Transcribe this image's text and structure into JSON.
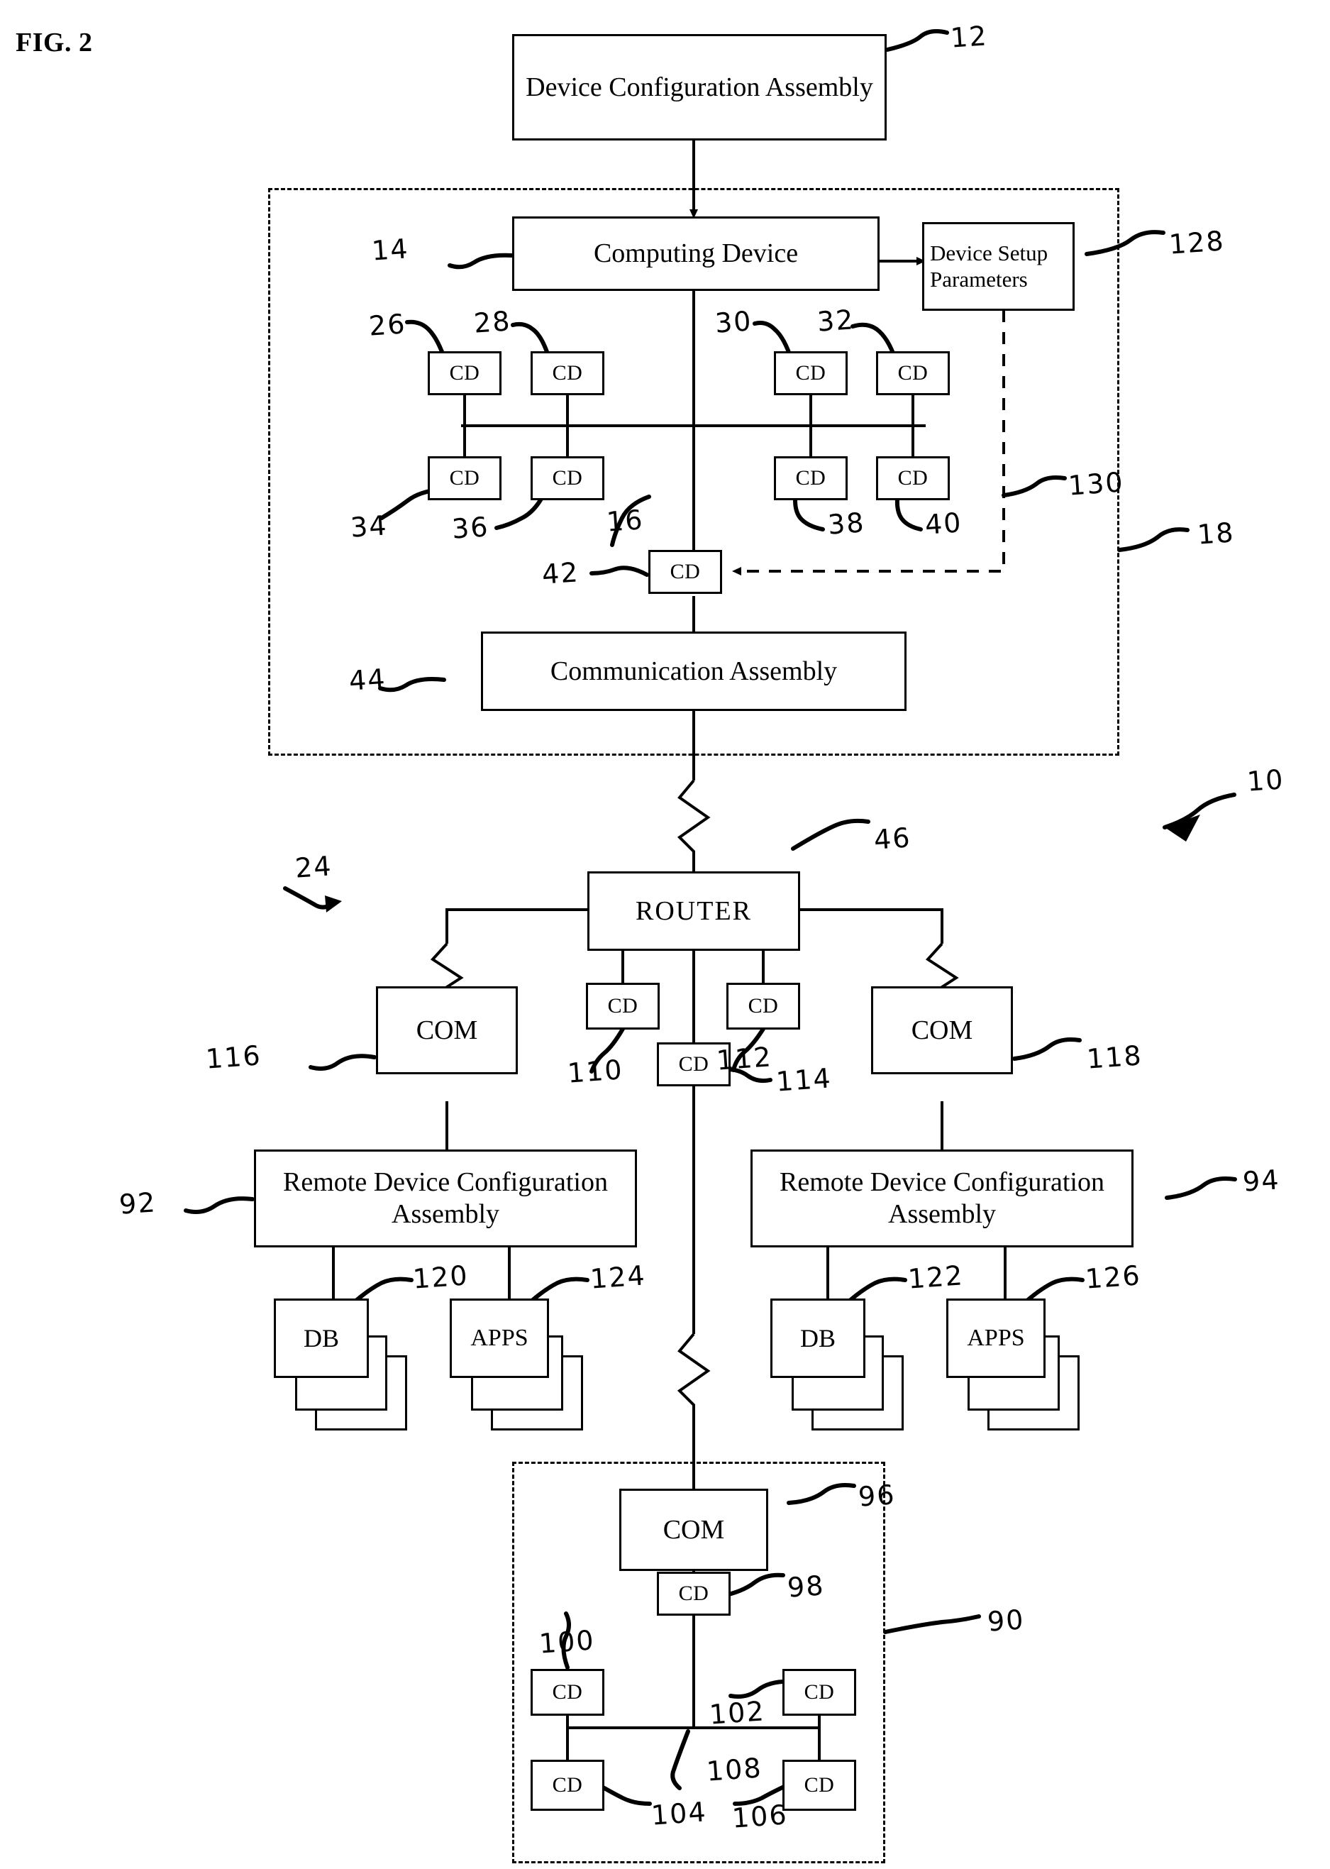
{
  "figure": {
    "label": "FIG. 2",
    "system_numeral": "10"
  },
  "boxes": {
    "device_configuration_assembly": "Device Configuration Assembly",
    "computing_device": "Computing Device",
    "device_setup_parameters": "Device Setup Parameters",
    "communication_assembly": "Communication Assembly",
    "router": "ROUTER",
    "remote_device_configuration_assembly_left": "Remote Device Configuration Assembly",
    "remote_device_configuration_assembly_right": "Remote Device Configuration Assembly",
    "com": "COM",
    "cd": "CD",
    "db": "DB",
    "apps": "APPS"
  },
  "numerals": {
    "n10": "10",
    "n12": "12",
    "n14": "14",
    "n16": "16",
    "n18": "18",
    "n24": "24",
    "n26": "26",
    "n28": "28",
    "n30": "30",
    "n32": "32",
    "n34": "34",
    "n36": "36",
    "n38": "38",
    "n40": "40",
    "n42": "42",
    "n44": "44",
    "n46": "46",
    "n90": "90",
    "n92": "92",
    "n94": "94",
    "n96": "96",
    "n98": "98",
    "n100": "100",
    "n102": "102",
    "n104": "104",
    "n106": "106",
    "n108": "108",
    "n110": "110",
    "n112": "112",
    "n114": "114",
    "n116": "116",
    "n118": "118",
    "n120": "120",
    "n122": "122",
    "n124": "124",
    "n126": "126",
    "n128": "128",
    "n130": "130"
  },
  "nodes": {
    "cd_26": "CD",
    "cd_28": "CD",
    "cd_30": "CD",
    "cd_32": "CD",
    "cd_34": "CD",
    "cd_36": "CD",
    "cd_38": "CD",
    "cd_40": "CD",
    "cd_42": "CD",
    "cd_98": "CD",
    "cd_100": "CD",
    "cd_102": "CD",
    "cd_104": "CD",
    "cd_106": "CD",
    "cd_110": "CD",
    "cd_112": "CD",
    "cd_114": "CD",
    "com_96": "COM",
    "com_116": "COM",
    "com_118": "COM",
    "db_120": "DB",
    "db_122": "DB",
    "apps_124": "APPS",
    "apps_126": "APPS"
  },
  "colors": {
    "ink": "#000000",
    "paper": "#ffffff"
  }
}
